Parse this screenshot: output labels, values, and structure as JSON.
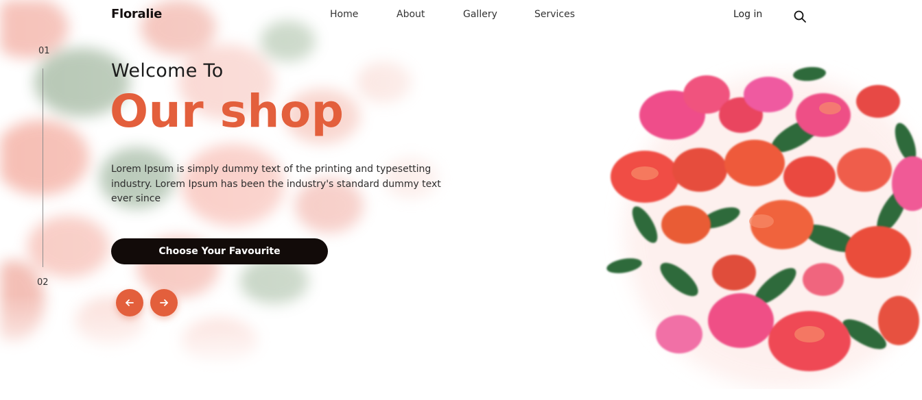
{
  "header": {
    "logo": "Floralie",
    "nav": [
      "Home",
      "About",
      "Gallery",
      "Services"
    ],
    "login_label": "Log in",
    "search_icon": "search-icon"
  },
  "slider": {
    "current": "01",
    "next": "02"
  },
  "hero": {
    "welcome": "Welcome To",
    "headline": "Our shop",
    "description": "Lorem Ipsum is simply dummy text of the printing and typesetting industry. Lorem Ipsum has been the industry's standard dummy text ever since",
    "cta_label": "Choose Your Favourite",
    "prev_icon": "arrow-left-icon",
    "next_icon": "arrow-right-icon"
  },
  "colors": {
    "accent": "#e35f3c",
    "button_dark": "#120b09",
    "text_dark": "#1b1b1b"
  }
}
